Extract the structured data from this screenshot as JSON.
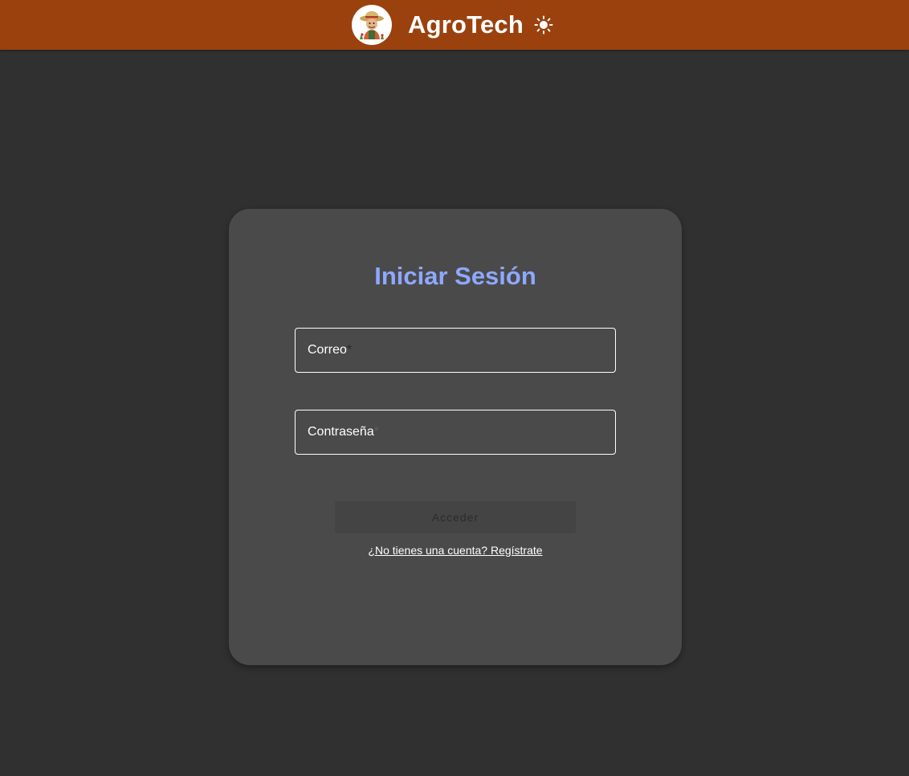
{
  "header": {
    "app_title": "AgroTech",
    "logo_icon": "farmer-mascot-icon",
    "theme_toggle_icon": "sun-icon"
  },
  "login": {
    "title": "Iniciar Sesión",
    "email_label": "Correo",
    "password_label": "Contraseña",
    "required_mark": "*",
    "submit_label": "Acceder",
    "register_link": "¿No tienes una cuenta? Regístrate"
  },
  "colors": {
    "header_bg": "#9a410e",
    "page_bg": "#303030",
    "card_bg": "#4a4a4a",
    "title_accent": "#8ea8ff"
  }
}
